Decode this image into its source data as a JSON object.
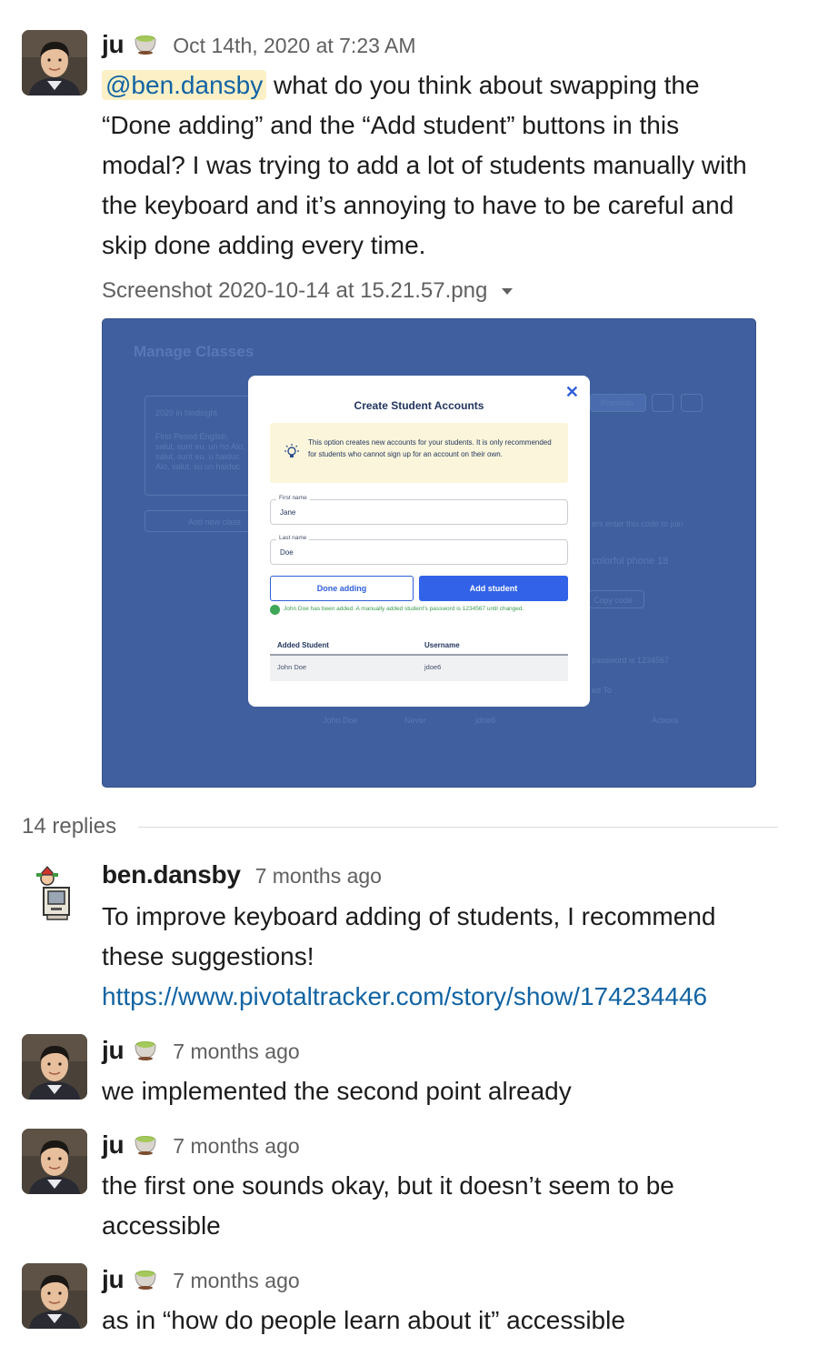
{
  "message": {
    "author": "ju",
    "status_icon": "teapot-icon",
    "time": "Oct 14th, 2020 at 7:23 AM",
    "mention": "@ben.dansby",
    "text_lines": [
      " what do you think about swapping the",
      "“Done adding” and the “Add student” buttons in this",
      "modal? I was trying to add a lot of students manually with",
      "the keyboard and it’s annoying to have to be careful and",
      "skip done adding every time."
    ],
    "attachment": {
      "filename": "Screenshot 2020-10-14 at 15.21.57.png",
      "screenshot": {
        "background_title": "Manage Classes",
        "background_texts": {
          "class_name": "2020 in hindsight",
          "class_desc": "First Period English, salut, sunt eu, un ho Alo, salut, sunt eu, u haiduc Alo, salut, su un haiduc",
          "add_new_class": "Add new class",
          "premium": "Premium",
          "join_hint": "ers enter this code to join",
          "class_code": "colorful phone 18",
          "copy_code": "Copy code",
          "password_hint": "password is 1234567",
          "assigned_to": "ed To",
          "row_name": "John Doe",
          "row_never": "Never",
          "row_user": "jdoe6",
          "actions": "Actions"
        },
        "modal": {
          "title": "Create Student Accounts",
          "close_icon": "close-icon",
          "info_icon": "lightbulb-icon",
          "info_text": "This option creates new accounts for your students. It is only recommended for students who cannot sign up for an account on their own.",
          "first_name_label": "First name",
          "first_name_value": "Jane",
          "last_name_label": "Last name",
          "last_name_value": "Doe",
          "done_button": "Done adding",
          "add_button": "Add student",
          "success_text": "John Doe has been added. A manually added student's password is 1234567 until changed.",
          "table_headers": [
            "Added Student",
            "Username"
          ],
          "table_rows": [
            [
              "John Doe",
              "jdoe6"
            ]
          ]
        }
      }
    }
  },
  "thread": {
    "replies_label": "14 replies",
    "replies": [
      {
        "author": "ben.dansby",
        "time": "7 months ago",
        "lines": [
          "To improve keyboard adding of students, I recommend",
          "these suggestions!"
        ],
        "link": "https://www.pivotaltracker.com/story/show/174234446"
      },
      {
        "author": "ju",
        "time": "7 months ago",
        "lines": [
          "we implemented the second point already"
        ]
      },
      {
        "author": "ju",
        "time": "7 months ago",
        "lines": [
          "the first one sounds okay, but it doesn’t seem to be",
          "accessible"
        ]
      },
      {
        "author": "ju",
        "time": "7 months ago",
        "lines": [
          "as in “how do people learn about it” accessible"
        ]
      }
    ]
  },
  "colors": {
    "link": "#1264a3",
    "mention_bg": "#fcf0c7",
    "screenshot_overlay": "#3f5f9e",
    "primary_button": "#3162e8",
    "success": "#3ea857"
  }
}
